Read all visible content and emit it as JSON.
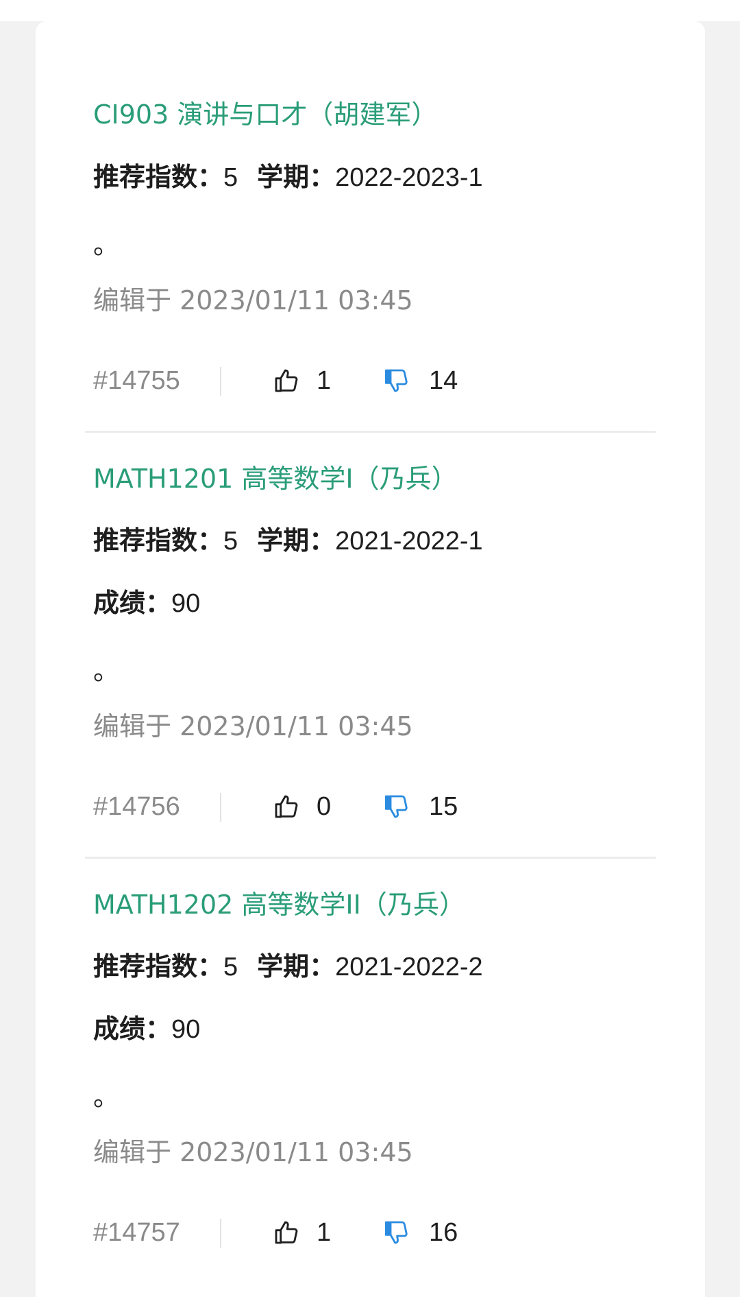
{
  "labels": {
    "rating": "推荐指数：",
    "semester": "学期：",
    "grade": "成绩："
  },
  "colors": {
    "title": "#2a9d78",
    "dislike_active": "#2b8be0",
    "muted": "#8a8a8a"
  },
  "reviews": [
    {
      "title": "CI903 演讲与口才（胡建军）",
      "rating": "5",
      "semester": "2022-2023-1",
      "grade": null,
      "body": "。",
      "edited": "编辑于 2023/01/11 03:45",
      "post_id": "#14755",
      "likes": "1",
      "dislikes": "14",
      "like_icon": "thumbs-up-outline",
      "dislike_icon": "thumbs-down-filled"
    },
    {
      "title": "MATH1201 高等数学I（乃兵）",
      "rating": "5",
      "semester": "2021-2022-1",
      "grade": "90",
      "body": "。",
      "edited": "编辑于 2023/01/11 03:45",
      "post_id": "#14756",
      "likes": "0",
      "dislikes": "15",
      "like_icon": "thumbs-up-outline",
      "dislike_icon": "thumbs-down-filled"
    },
    {
      "title": "MATH1202 高等数学II（乃兵）",
      "rating": "5",
      "semester": "2021-2022-2",
      "grade": "90",
      "body": "。",
      "edited": "编辑于 2023/01/11 03:45",
      "post_id": "#14757",
      "likes": "1",
      "dislikes": "16",
      "like_icon": "thumbs-up-outline",
      "dislike_icon": "thumbs-down-filled"
    }
  ]
}
